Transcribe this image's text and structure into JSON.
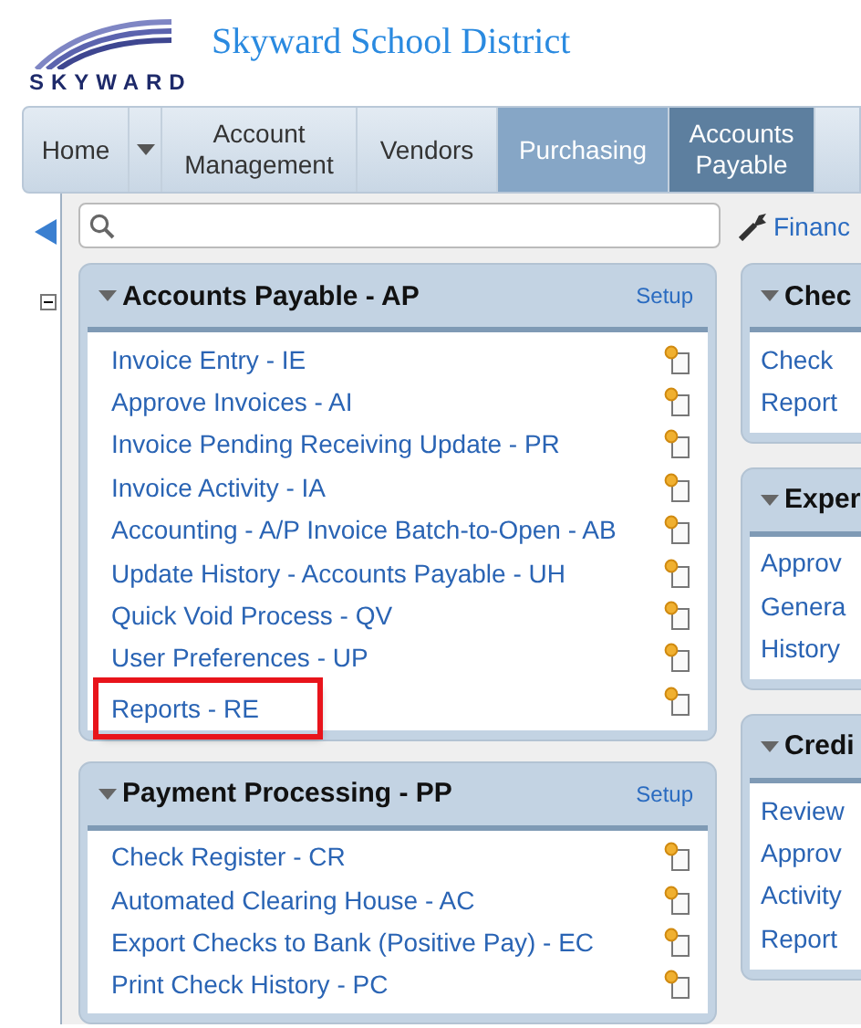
{
  "header": {
    "logo_text": "SKYWARD",
    "title": "Skyward School District"
  },
  "nav_tabs": [
    {
      "kind": "tab",
      "label": "Home",
      "selected": false,
      "hovered": false
    },
    {
      "kind": "dropdown",
      "selected": false,
      "hovered": false
    },
    {
      "kind": "tab",
      "label": "Account Management",
      "selected": false,
      "hovered": false
    },
    {
      "kind": "tab",
      "label": "Vendors",
      "selected": false,
      "hovered": false
    },
    {
      "kind": "tab",
      "label": "Purchasing",
      "selected": false,
      "hovered": true
    },
    {
      "kind": "tab",
      "label": "Accounts Payable",
      "selected": true,
      "hovered": false
    }
  ],
  "toolbar": {
    "tool_link": "Financ"
  },
  "left_column": [
    {
      "title": "Accounts Payable - AP",
      "setup": "Setup",
      "items": [
        {
          "label": "Invoice Entry - IE",
          "highlighted": false
        },
        {
          "label": "Approve Invoices - AI",
          "highlighted": false
        },
        {
          "label": "Invoice Pending Receiving Update - PR",
          "highlighted": false
        },
        {
          "label": "Invoice Activity - IA",
          "highlighted": false
        },
        {
          "label": "Accounting - A/P Invoice Batch-to-Open - AB",
          "highlighted": false
        },
        {
          "label": "Update History - Accounts Payable - UH",
          "highlighted": false
        },
        {
          "label": "Quick Void Process - QV",
          "highlighted": false
        },
        {
          "label": "User Preferences - UP",
          "highlighted": false
        },
        {
          "label": "Reports - RE",
          "highlighted": true
        }
      ]
    },
    {
      "title": "Payment Processing - PP",
      "setup": "Setup",
      "items": [
        {
          "label": "Check Register - CR",
          "highlighted": false
        },
        {
          "label": "Automated Clearing House - AC",
          "highlighted": false
        },
        {
          "label": "Export Checks to Bank (Positive Pay) - EC",
          "highlighted": false
        },
        {
          "label": "Print Check History - PC",
          "highlighted": false
        }
      ]
    }
  ],
  "right_column": [
    {
      "title": "Chec",
      "items": [
        "Check",
        "Report"
      ]
    },
    {
      "title": "Exper",
      "items": [
        "Approv",
        "Genera",
        "History"
      ]
    },
    {
      "title": "Credi",
      "items": [
        "Review",
        "Approv",
        "Activity",
        "Report"
      ]
    }
  ]
}
